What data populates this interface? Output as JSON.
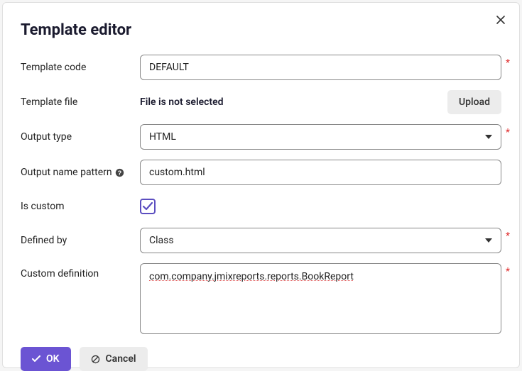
{
  "title": "Template editor",
  "fields": {
    "template_code": {
      "label": "Template code",
      "value": "DEFAULT"
    },
    "template_file": {
      "label": "Template file",
      "status": "File is not selected",
      "upload_label": "Upload"
    },
    "output_type": {
      "label": "Output type",
      "value": "HTML"
    },
    "output_name_pattern": {
      "label": "Output name pattern",
      "value": "custom.html"
    },
    "is_custom": {
      "label": "Is custom",
      "checked": true
    },
    "defined_by": {
      "label": "Defined by",
      "value": "Class"
    },
    "custom_definition": {
      "label": "Custom definition",
      "value": "com.company.jmixreports.reports.BookReport"
    }
  },
  "buttons": {
    "ok": "OK",
    "cancel": "Cancel"
  }
}
